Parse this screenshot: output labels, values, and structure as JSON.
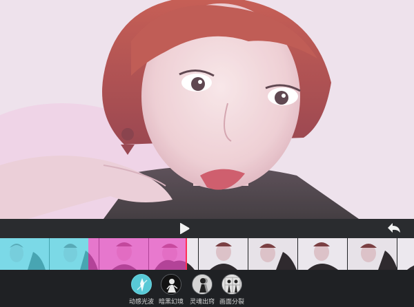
{
  "app": {
    "accent_color": "#ff2f56",
    "preview_tint": "#e9dbe8"
  },
  "controls": {
    "play_icon": "play-icon",
    "undo_icon": "undo-icon"
  },
  "timeline": {
    "segments": [
      {
        "effect": "动感光波",
        "color": "#52d6e6"
      },
      {
        "effect": "暗黑幻境",
        "color": "#e64ec2"
      }
    ],
    "frame_count": 9
  },
  "effects": {
    "items": [
      {
        "label": "动感光波",
        "icon": "light-wave-icon",
        "selected": true
      },
      {
        "label": "暗黑幻境",
        "icon": "dark-illusion-icon",
        "selected": false
      },
      {
        "label": "灵魂出窍",
        "icon": "soul-out-icon",
        "selected": false
      },
      {
        "label": "画面分裂",
        "icon": "split-screen-icon",
        "selected": false
      }
    ]
  }
}
